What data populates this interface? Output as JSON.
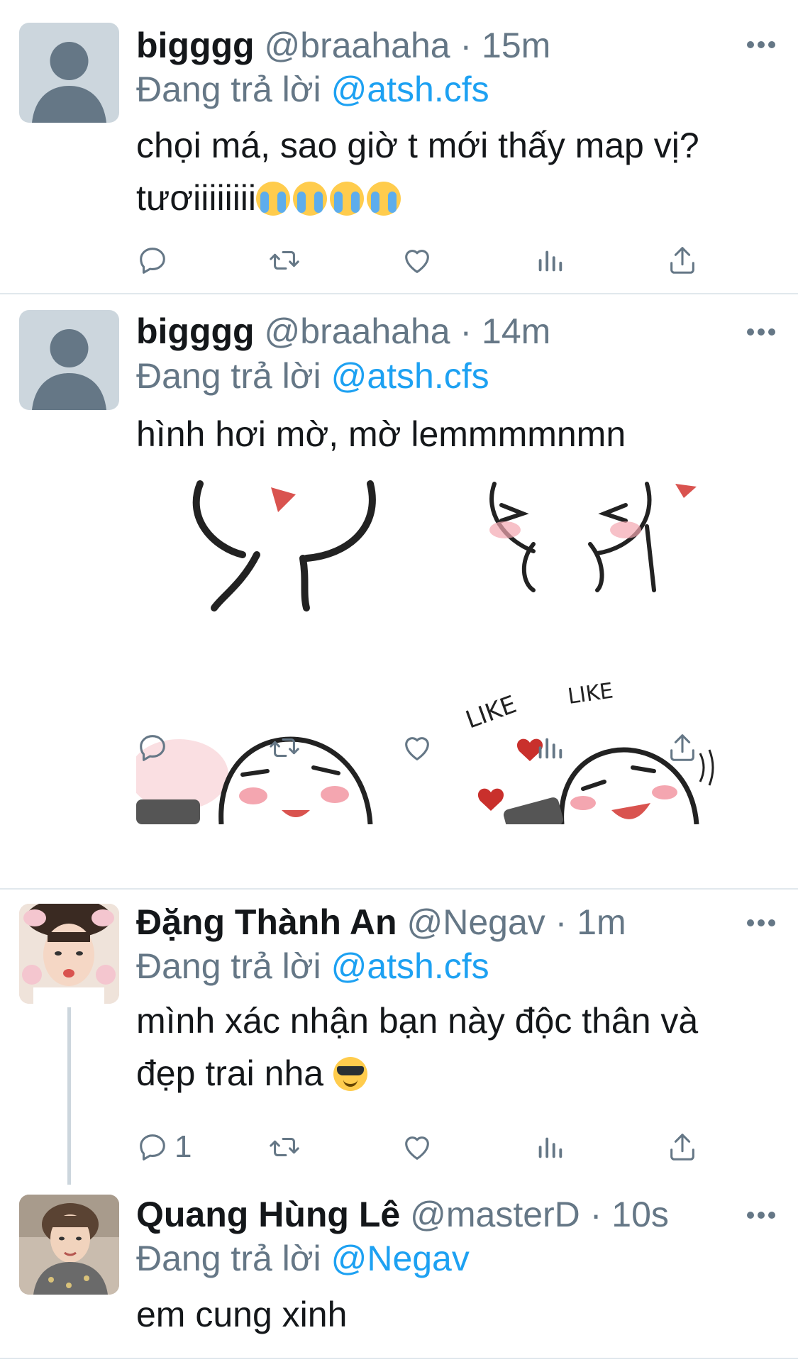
{
  "tweets": [
    {
      "name": "bigggg",
      "handle": "@braahaha",
      "separator": "·",
      "time": "15m",
      "reply_prefix": "Đang trả lời",
      "reply_to": "@atsh.cfs",
      "text_line1": "chọi má, sao giờ t mới thấy map vị?",
      "text_line2": "tươiiiiiiii",
      "emojis": [
        "loudly-crying-face",
        "loudly-crying-face",
        "loudly-crying-face",
        "loudly-crying-face"
      ],
      "reply_count": ""
    },
    {
      "name": "bigggg",
      "handle": "@braahaha",
      "separator": "·",
      "time": "14m",
      "reply_prefix": "Đang trả lời",
      "reply_to": "@atsh.cfs",
      "text_line1": "hình hơi mờ, mờ lemmmmnmn",
      "media_text": [
        "LIKE",
        "LIKE"
      ],
      "reply_count": ""
    },
    {
      "name": "Đặng Thành An",
      "handle": "@Negav",
      "separator": "·",
      "time": "1m",
      "reply_prefix": "Đang trả lời",
      "reply_to": "@atsh.cfs",
      "text_line1": "mình xác nhận bạn này độc thân và",
      "text_line2": "đẹp trai nha",
      "emojis": [
        "smiling-face-with-sunglasses"
      ],
      "reply_count": "1"
    },
    {
      "name": "Quang Hùng Lê",
      "handle": "@masterD",
      "separator": "·",
      "time": "10s",
      "reply_prefix": "Đang trả lời",
      "reply_to": "@Negav",
      "text_line1": "em cung xinh"
    }
  ],
  "icons": {
    "reply": "reply-icon",
    "retweet": "retweet-icon",
    "like": "heart-icon",
    "analytics": "analytics-icon",
    "share": "share-icon",
    "more": "more-options-icon"
  },
  "colors": {
    "link": "#1da1f2",
    "secondary_text": "#657786",
    "divider": "#e1e8ed"
  }
}
